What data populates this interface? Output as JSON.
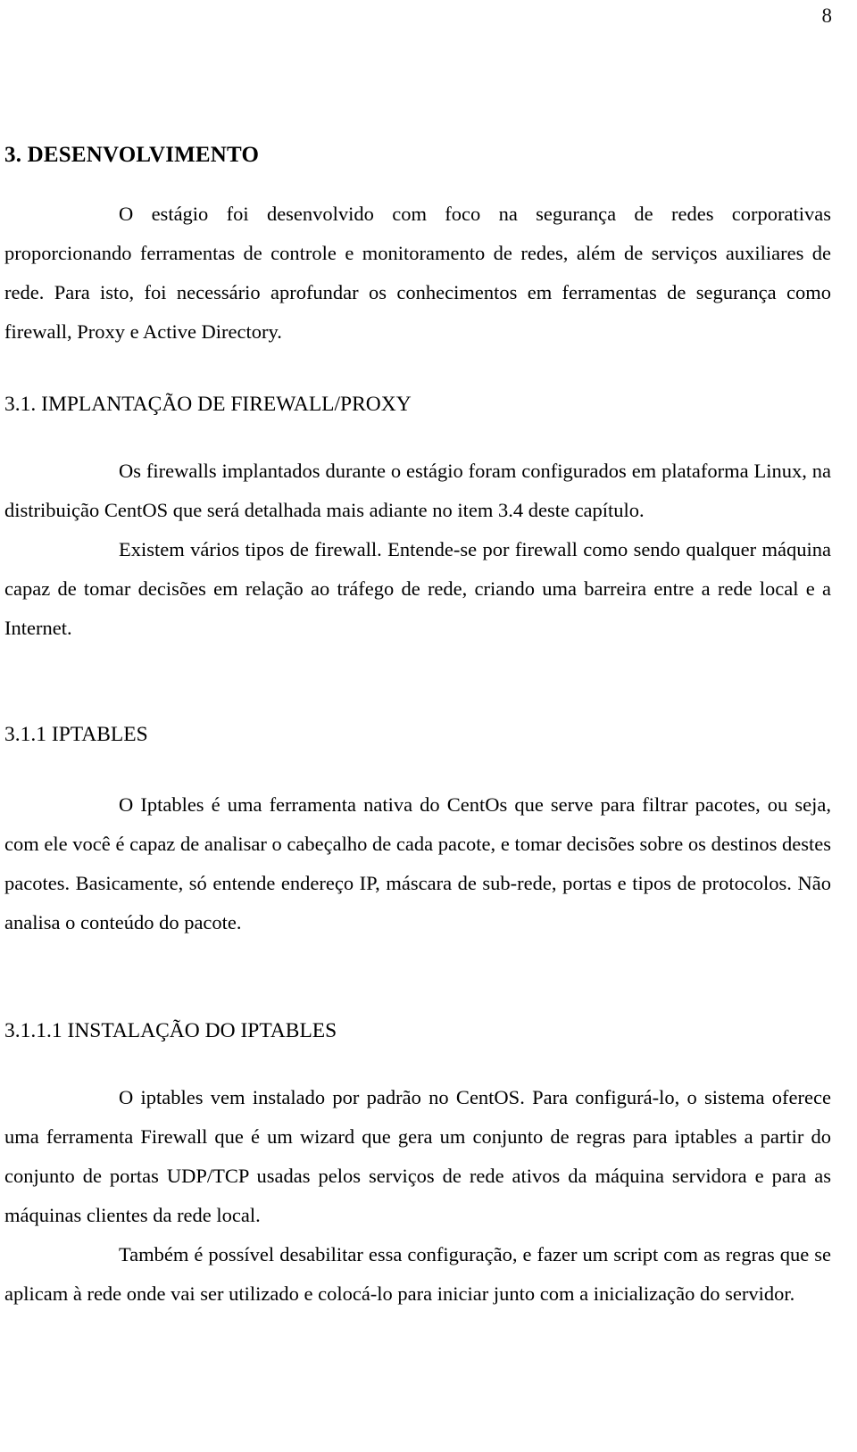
{
  "document": {
    "page_number": "8",
    "language": "pt-BR",
    "headings": {
      "chapter": "3. DESENVOLVIMENTO",
      "section": "3.1. IMPLANTAÇÃO DE FIREWALL/PROXY",
      "subsection": "3.1.1 IPTABLES",
      "subsubsection": "3.1.1.1 INSTALAÇÃO DO IPTABLES"
    },
    "paragraphs": {
      "intro": "O estágio foi desenvolvido com foco na segurança de redes corporativas proporcionando ferramentas de controle e monitoramento de redes, além de serviços auxiliares de rede. Para isto, foi necessário aprofundar os conhecimentos em ferramentas de segurança como firewall, Proxy e Active Directory.",
      "firewall_platform": "Os firewalls implantados durante o estágio foram configurados em plataforma Linux, na distribuição CentOS que será detalhada mais adiante no item 3.4 deste capítulo.",
      "firewall_definition": "Existem vários tipos de firewall. Entende-se por firewall como sendo qualquer máquina capaz de tomar decisões em relação ao tráfego de rede, criando uma barreira entre a rede local e a Internet.",
      "iptables_overview": "O Iptables é uma ferramenta nativa do CentOs que serve para filtrar pacotes, ou seja, com ele você é capaz de analisar o cabeçalho de cada pacote, e tomar decisões sobre os destinos destes pacotes. Basicamente, só entende endereço IP, máscara de sub-rede, portas e tipos de protocolos.   Não analisa o conteúdo do pacote.",
      "iptables_install": "O iptables vem instalado por padrão no CentOS. Para configurá-lo, o sistema oferece uma ferramenta Firewall que é um wizard que gera um conjunto de regras para iptables a partir do conjunto de portas UDP/TCP usadas pelos serviços de rede ativos da máquina servidora e para as máquinas clientes da rede local.",
      "iptables_script": "Também é possível desabilitar essa configuração, e fazer um script com as regras que se aplicam à rede onde vai ser utilizado e colocá-lo para iniciar junto com a inicialização do servidor."
    }
  }
}
